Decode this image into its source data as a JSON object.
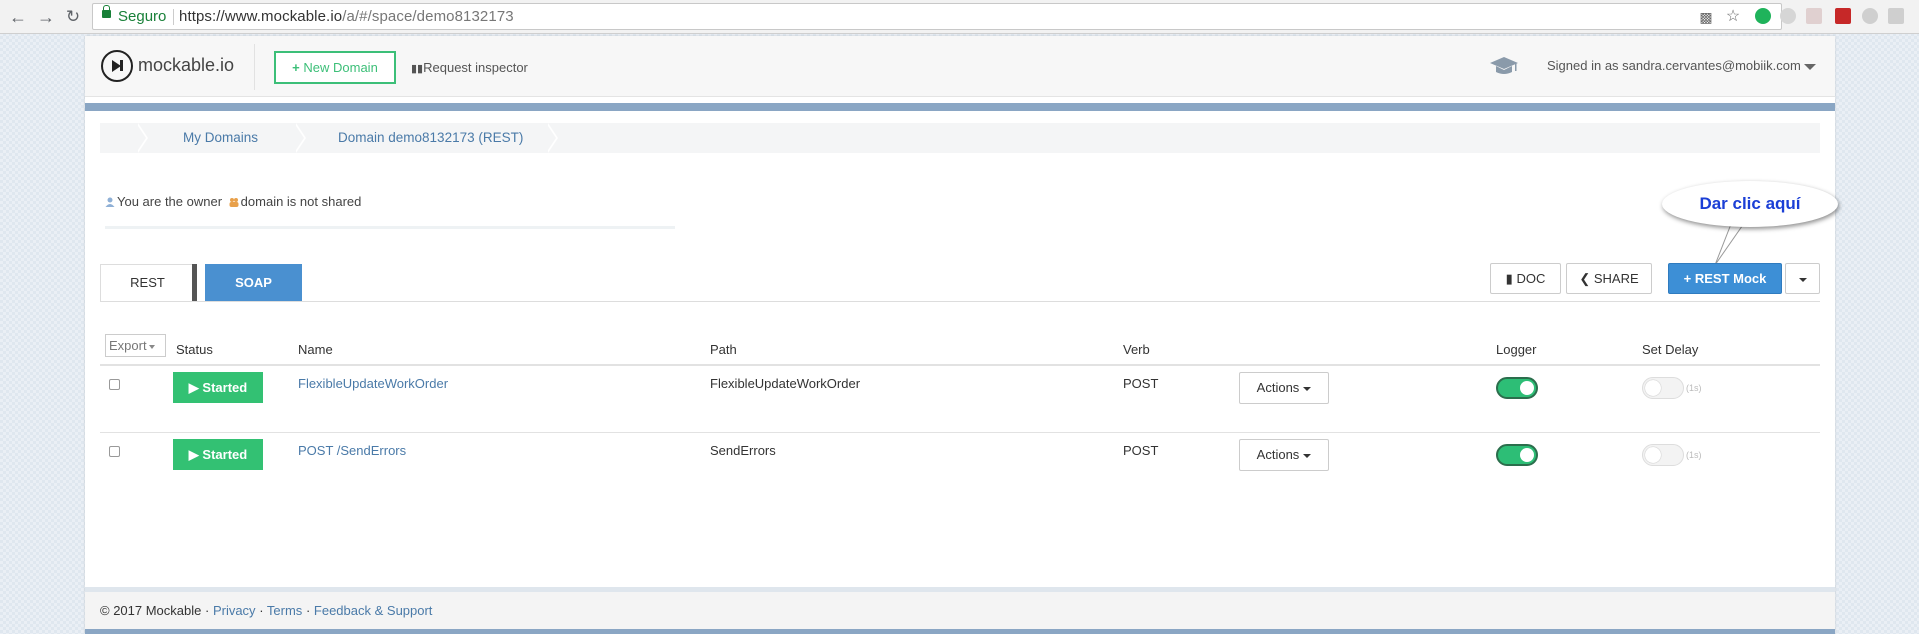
{
  "browser": {
    "secure_label": "Seguro",
    "url_host": "https://www.mockable.io",
    "url_path": "/a/#/space/demo8132173"
  },
  "header": {
    "brand": "mockable.io",
    "new_domain_label": "New Domain",
    "request_inspector_label": "Request inspector",
    "signed_in_label": "Signed in as sandra.cervantes@mobiik.com"
  },
  "breadcrumb": {
    "items": [
      "My Domains",
      "Domain demo8132173 (REST)"
    ]
  },
  "ownership": {
    "owner_text": "You are the owner",
    "shared_text": "domain is not shared"
  },
  "callout": {
    "text": "Dar clic aquí"
  },
  "tabs": {
    "rest": "REST",
    "soap": "SOAP"
  },
  "toolbar": {
    "doc_label": "DOC",
    "share_label": "SHARE",
    "rest_mock_label": "REST Mock"
  },
  "table": {
    "export_label": "Export",
    "headers": {
      "status": "Status",
      "name": "Name",
      "path": "Path",
      "verb": "Verb",
      "logger": "Logger",
      "set_delay": "Set Delay"
    },
    "rows": [
      {
        "status": "Started",
        "name": "FlexibleUpdateWorkOrder",
        "path": "FlexibleUpdateWorkOrder",
        "verb": "POST",
        "actions": "Actions",
        "logger": true,
        "delay_label": "(1s)"
      },
      {
        "status": "Started",
        "name": "POST /SendErrors",
        "path": "SendErrors",
        "verb": "POST",
        "actions": "Actions",
        "logger": true,
        "delay_label": "(1s)"
      }
    ]
  },
  "footer": {
    "copyright": "© 2017 Mockable ·",
    "privacy": "Privacy",
    "terms": "Terms",
    "feedback": "Feedback & Support",
    "sep": "·"
  },
  "colors": {
    "accent_green": "#33c173",
    "primary_blue": "#3d8fd6",
    "link_blue": "#4a7aa8",
    "callout_text": "#1b3fd6"
  }
}
